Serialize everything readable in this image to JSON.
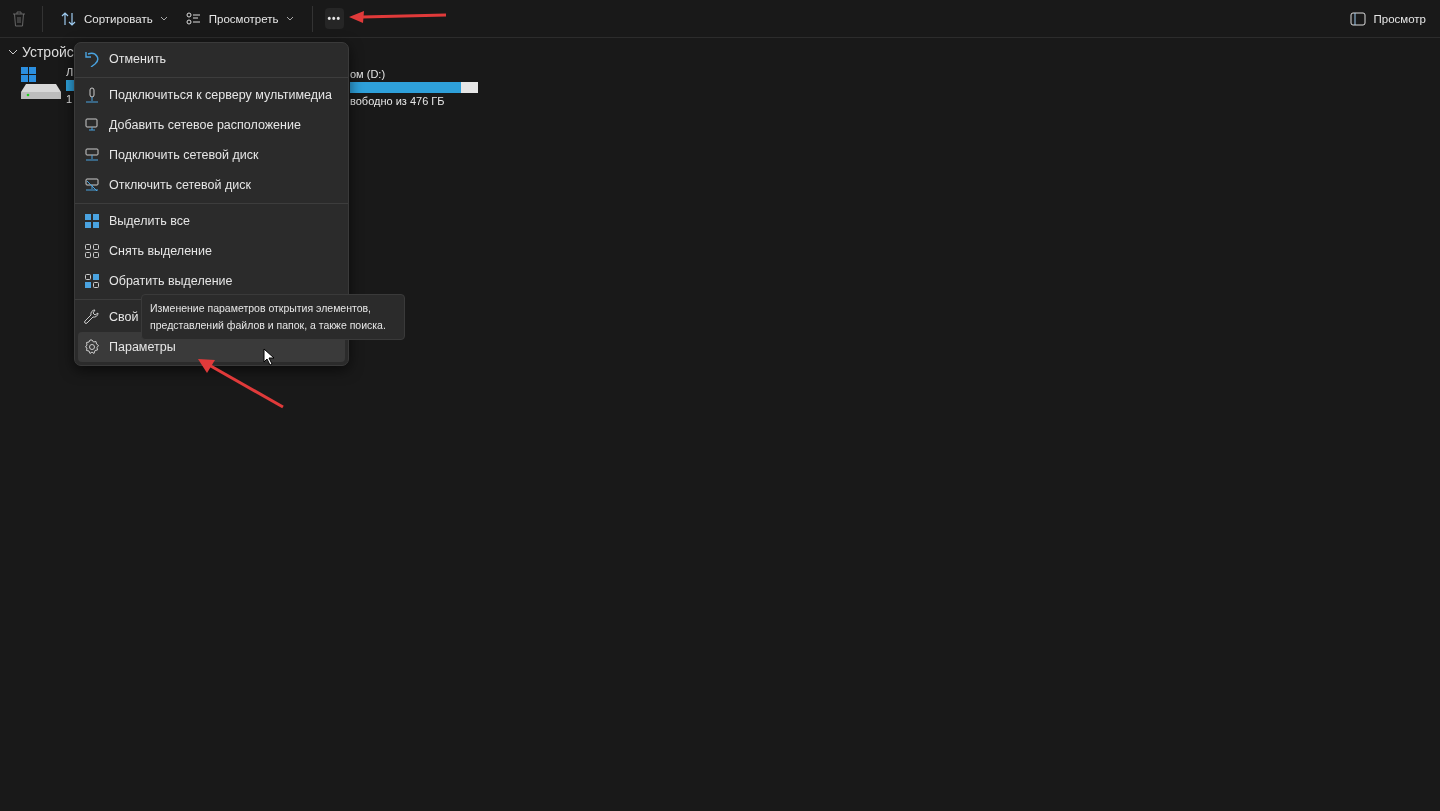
{
  "toolbar": {
    "buttons": [
      {
        "label": "Сортировать",
        "dropdown": true
      },
      {
        "label": "Просмотреть",
        "dropdown": true
      }
    ],
    "more": {
      "label": "•••",
      "expanded": true
    },
    "details_pane": {
      "label": "Просмотр"
    }
  },
  "section": {
    "title": "Устройс",
    "expanded": true
  },
  "drives": [
    {
      "name": "Л",
      "free": "1"
    },
    {
      "name": "ом (D:)",
      "free": "вободно из 476 ГБ",
      "level": 0.87
    }
  ],
  "menu": {
    "groups": [
      [
        {
          "label": "Отменить",
          "hovered": false
        }
      ],
      [
        {
          "label": "Подключиться к серверу мультимедиа",
          "hovered": false
        },
        {
          "label": "Добавить сетевое расположение",
          "hovered": false
        },
        {
          "label": "Подключить сетевой диск",
          "hovered": false
        },
        {
          "label": "Отключить сетевой диск",
          "hovered": false
        }
      ],
      [
        {
          "label": "Выделить все",
          "hovered": false
        },
        {
          "label": "Снять выделение",
          "hovered": false
        },
        {
          "label": "Обратить выделение",
          "hovered": false
        }
      ],
      [
        {
          "label": "Свой",
          "hovered": false
        },
        {
          "label": "Параметры",
          "hovered": true
        }
      ]
    ]
  },
  "tooltip": {
    "text": "Изменение параметров открытия элементов, представлений файлов и папок, а также поиска."
  }
}
